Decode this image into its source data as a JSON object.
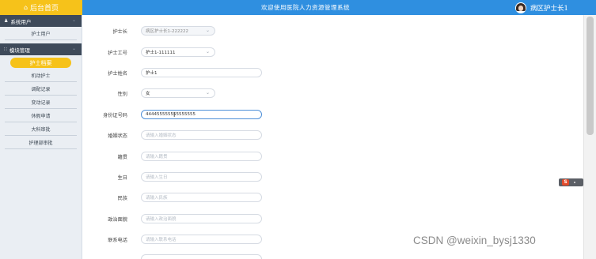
{
  "header": {
    "home_label": "后台首页",
    "home_icon": "home-icon",
    "title": "欢迎使用医院人力资源管理系统",
    "user_name": "病区护士长1",
    "colors": {
      "bar": "#2f8fe0",
      "home": "#f6c21a"
    }
  },
  "sidebar": {
    "sections": [
      {
        "label": "系统用户",
        "icon": "user-icon"
      },
      {
        "label": "模块管理",
        "icon": "grid-icon"
      }
    ],
    "items": [
      {
        "label": "护士用户"
      },
      {
        "label": "护士档案",
        "active": true
      },
      {
        "label": "机动护士"
      },
      {
        "label": "调配记录"
      },
      {
        "label": "变动记录"
      },
      {
        "label": "休假申请"
      },
      {
        "label": "大科审批"
      },
      {
        "label": "护理部审批"
      }
    ]
  },
  "form": {
    "fields": [
      {
        "label": "护士长",
        "value": "病区护士长1-222222",
        "type": "select",
        "readonly": true
      },
      {
        "label": "护士工号",
        "value": "护士1-111111",
        "type": "select"
      },
      {
        "label": "护士姓名",
        "value": "护士1",
        "type": "input"
      },
      {
        "label": "性别",
        "value": "女",
        "type": "select"
      },
      {
        "label": "身份证号码",
        "value": "444455555555555555",
        "type": "input",
        "focused": true
      },
      {
        "label": "婚姻状态",
        "placeholder": "请输入婚姻状态",
        "type": "input"
      },
      {
        "label": "籍贯",
        "placeholder": "请输入籍贯",
        "type": "input"
      },
      {
        "label": "生日",
        "placeholder": "请输入生日",
        "type": "input"
      },
      {
        "label": "民族",
        "placeholder": "请输入民族",
        "type": "input"
      },
      {
        "label": "政治面貌",
        "placeholder": "请输入政治面貌",
        "type": "input"
      },
      {
        "label": "联系电话",
        "placeholder": "请输入联系电话",
        "type": "input"
      }
    ]
  },
  "watermark": "CSDN @weixin_bysj1330"
}
